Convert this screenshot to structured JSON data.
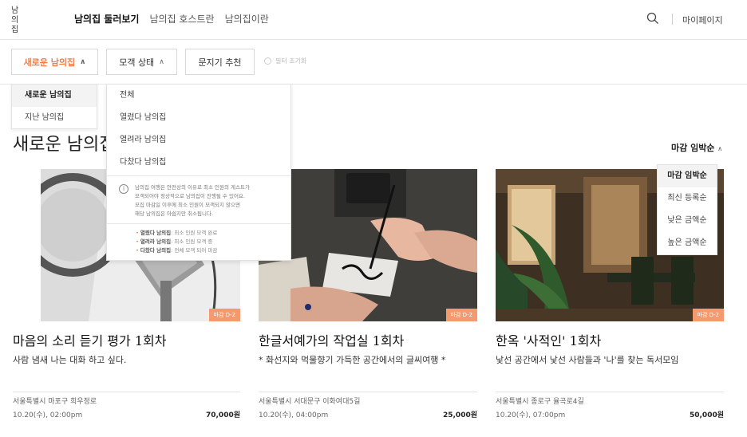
{
  "header": {
    "logo_text": "남의집",
    "nav": [
      {
        "label": "남의집 둘러보기",
        "active": true
      },
      {
        "label": "남의집 호스트란",
        "active": false
      },
      {
        "label": "남의집이란",
        "active": false
      }
    ],
    "search_icon": "search-icon",
    "mypage_label": "마이페이지"
  },
  "filters": {
    "new_label": "새로운 남의집",
    "status_label": "모객 상태",
    "door_label": "문지기 추천",
    "reset_label": "필터 초기화",
    "accent_color": "#f07d4a"
  },
  "dropdown_type": {
    "items": [
      {
        "label": "새로운 남의집",
        "selected": true
      },
      {
        "label": "지난 남의집",
        "selected": false
      }
    ]
  },
  "dropdown_status": {
    "items": [
      "전체",
      "열렸다 남의집",
      "열려라 남의집",
      "다찼다 남의집"
    ],
    "note_lines": [
      "남의집 여행은 안전상의 이유로 최소 인원의 게스트가",
      "모객되어야 정상적으로 남의집이 진행될 수 있어요.",
      "모집 마감일 이후에 최소 인원이 모객되지 않으면",
      "해당 남의집은 아쉽지만 취소됩니다."
    ],
    "legend": [
      {
        "term": "열렸다 남의집",
        "desc": ": 최소 인원 모객 완료"
      },
      {
        "term": "열려라 남의집",
        "desc": ": 최소 인원 모객 중"
      },
      {
        "term": "다찼다 남의집",
        "desc": ": 전체 모객 되어 마감"
      }
    ]
  },
  "page": {
    "title": "새로운 남의집",
    "sort_label": "마감 임박순"
  },
  "sort_menu": {
    "items": [
      {
        "label": "마감 임박순",
        "selected": true
      },
      {
        "label": "최신 등록순",
        "selected": false
      },
      {
        "label": "낮은 금액순",
        "selected": false
      },
      {
        "label": "높은 금액순",
        "selected": false
      }
    ]
  },
  "cards": [
    {
      "badge": "마감 D-2",
      "title": "마음의 소리 듣기 평가 1회차",
      "subtitle": "사람 냄새 나는 대화 하고 싶다.",
      "address": "서울특별시 마포구 희우정로",
      "date": "10.20(수), 02:00pm",
      "price": "70,000원"
    },
    {
      "badge": "마감 D-2",
      "title": "한글서예가의 작업실 1회차",
      "subtitle": "* 화선지와 먹물향기 가득한 공간에서의 글씨여행 *",
      "address": "서울특별시 서대문구 이화여대5길",
      "date": "10.20(수), 04:00pm",
      "price": "25,000원"
    },
    {
      "badge": "마감 D-2",
      "title": "한옥 '사적인' 1회차",
      "subtitle": "낯선 공간에서 낯선 사람들과 '나'를 찾는 독서모임",
      "address": "서울특별시 종로구 율곡로4길",
      "date": "10.20(수), 07:00pm",
      "price": "50,000원"
    }
  ]
}
